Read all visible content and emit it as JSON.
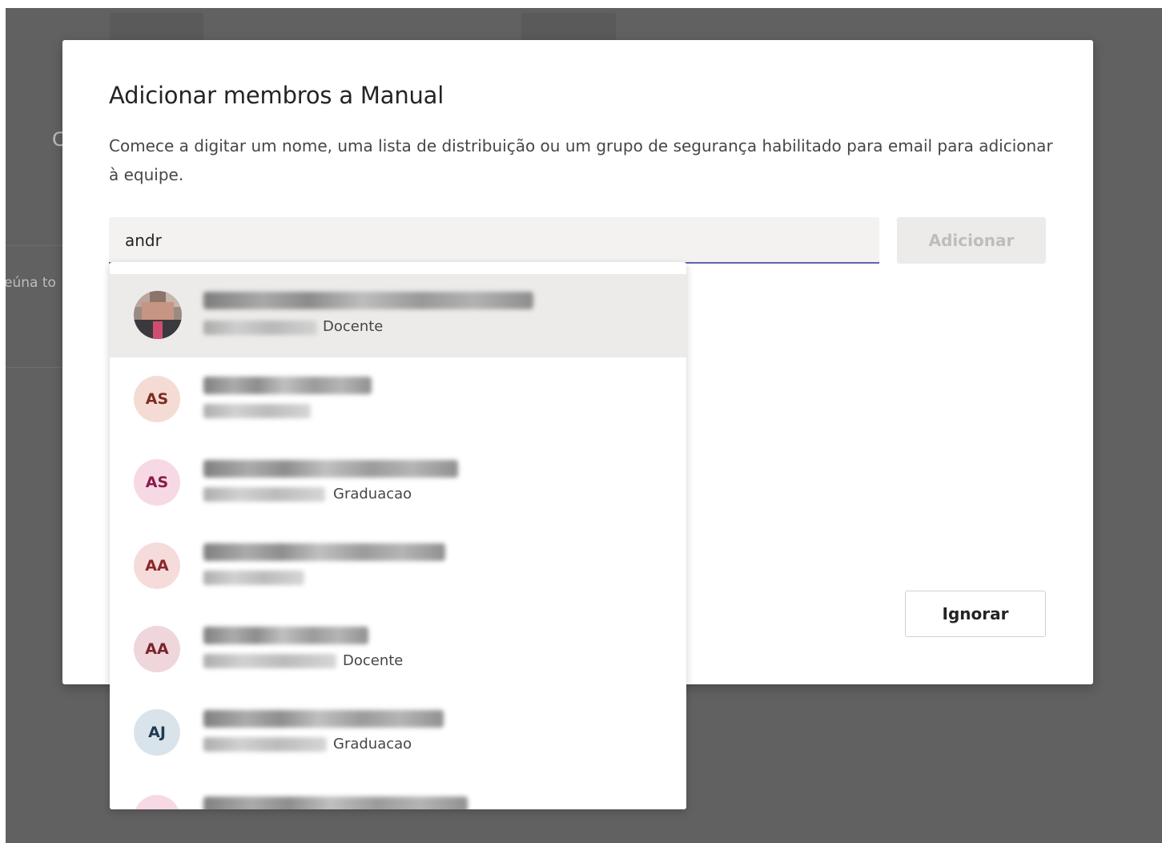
{
  "dialog": {
    "title": "Adicionar membros a Manual",
    "description": "Comece a digitar um nome, uma lista de distribuição ou um grupo de segurança habilitado para email para adicionar à equipe.",
    "search_value": "andr",
    "add_label": "Adicionar",
    "ignore_label": "Ignorar"
  },
  "background": {
    "left_letter": "C",
    "left_text": "eúna to"
  },
  "suggestions": [
    {
      "initials": "",
      "avatar_type": "photo",
      "subtitle": "Docente",
      "selected": true
    },
    {
      "initials": "AS",
      "avatar_bg": "#f4dcd4",
      "avatar_fg": "#7f2b1f",
      "subtitle": ""
    },
    {
      "initials": "AS",
      "avatar_bg": "#f6d9e4",
      "avatar_fg": "#8b1a4a",
      "subtitle": "Graduacao"
    },
    {
      "initials": "AA",
      "avatar_bg": "#f6dbdb",
      "avatar_fg": "#8a2929",
      "subtitle": ""
    },
    {
      "initials": "AA",
      "avatar_bg": "#efd6da",
      "avatar_fg": "#7a2430",
      "subtitle": "Docente"
    },
    {
      "initials": "AJ",
      "avatar_bg": "#d9e3ea",
      "avatar_fg": "#1f3a4f",
      "subtitle": "Graduacao"
    },
    {
      "initials": "",
      "avatar_bg": "#f6d9e4",
      "avatar_fg": "#8b1a4a",
      "subtitle": ""
    }
  ]
}
